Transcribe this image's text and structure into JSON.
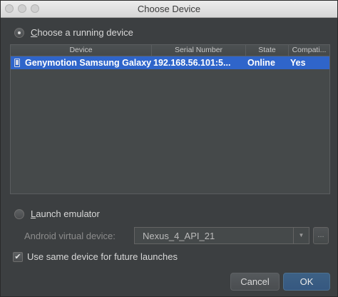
{
  "window": {
    "title": "Choose Device"
  },
  "running": {
    "label_first": "C",
    "label_rest": "hoose a running device"
  },
  "table": {
    "headers": [
      "Device",
      "Serial Number",
      "State",
      "Compati..."
    ],
    "rows": [
      {
        "device": "Genymotion Samsung Galaxy S",
        "serial": "192.168.56.101:5...",
        "state": "Online",
        "compatible": "Yes"
      }
    ]
  },
  "emulator": {
    "label_first": "L",
    "label_rest": "aunch emulator",
    "avd_label": "Android virtual device:",
    "avd_value": "Nexus_4_API_21",
    "more_label": "..."
  },
  "same_device": {
    "label": "Use same device for future launches",
    "checked": true
  },
  "buttons": {
    "cancel": "Cancel",
    "ok": "OK"
  }
}
